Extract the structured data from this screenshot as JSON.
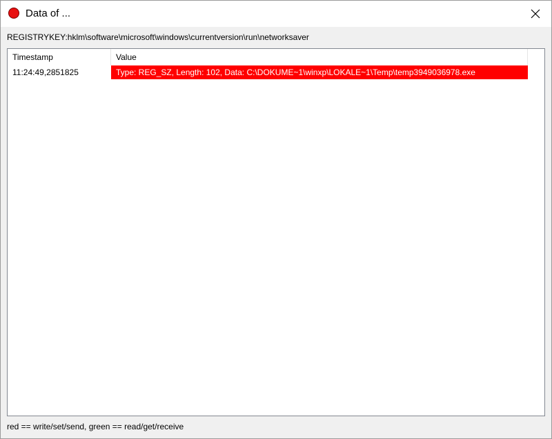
{
  "window": {
    "title": "Data of ..."
  },
  "path": {
    "label": "REGISTRYKEY:hklm\\software\\microsoft\\windows\\currentversion\\run\\networksaver"
  },
  "list": {
    "columns": [
      "Timestamp",
      "Value"
    ],
    "rows": [
      {
        "timestamp": "11:24:49,2851825",
        "value": "Type: REG_SZ, Length: 102, Data: C:\\DOKUME~1\\winxp\\LOKALE~1\\Temp\\temp3949036978.exe",
        "highlight_color": "#ff0000"
      }
    ]
  },
  "legend": {
    "text": "red == write/set/send, green == read/get/receive"
  },
  "colors": {
    "write": "#ff0000",
    "title_icon": "#e81010"
  },
  "icons": {
    "title": "red-circle-icon",
    "close": "close-icon"
  }
}
